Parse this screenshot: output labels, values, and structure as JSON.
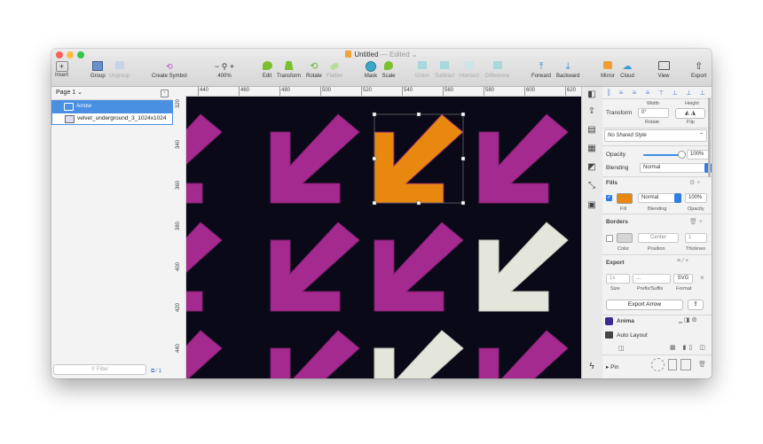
{
  "window": {
    "title": "Untitled",
    "title_suffix": " — Edited ⌄",
    "traffic_lights": [
      "#fc605c",
      "#fdbc40",
      "#34c84a"
    ]
  },
  "toolbar": {
    "insert": "Insert",
    "group": "Group",
    "ungroup": "Ungroup",
    "create_symbol": "Create Symbol",
    "zoom_level": "400%",
    "zoom_controls": "−  ⚲  +",
    "edit": "Edit",
    "transform": "Transform",
    "rotate": "Rotate",
    "flatten": "Flatten",
    "mask": "Mask",
    "scale": "Scale",
    "union": "Union",
    "subtract": "Subtract",
    "intersect": "Intersect",
    "difference": "Difference",
    "forward": "Forward",
    "backward": "Backward",
    "mirror": "Mirror",
    "cloud": "Cloud",
    "view": "View",
    "export": "Export"
  },
  "layers": {
    "page": "Page 1 ⌄",
    "items": [
      {
        "name": "Arrow",
        "icon": "vector-icon"
      },
      {
        "name": "velvet_underground_3_1024x1024",
        "icon": "image-icon"
      }
    ],
    "filter_placeholder": "Filter",
    "bottom_icons": "⧉ ⁄ 1"
  },
  "rulers": {
    "top": [
      "440",
      "460",
      "480",
      "500",
      "520",
      "540",
      "560",
      "580",
      "600",
      "620"
    ],
    "left": [
      "320",
      "340",
      "360",
      "380",
      "400",
      "420",
      "440"
    ]
  },
  "canvas": {
    "background": "#090917",
    "arrows": [
      {
        "color": "#a52a90"
      },
      {
        "color": "#a52a90"
      },
      {
        "color": "#e8880f"
      },
      {
        "color": "#a52a90"
      },
      {
        "color": "#a52a90"
      },
      {
        "color": "#a52a90"
      },
      {
        "color": "#a52a90"
      },
      {
        "color": "#e4e6dc"
      },
      {
        "color": "#a52a90"
      },
      {
        "color": "#a52a90"
      },
      {
        "color": "#e4e6dc"
      },
      {
        "color": "#a52a90"
      }
    ],
    "selection_color": "#6a6a6a"
  },
  "inspector": {
    "width_label": "Width",
    "height_label": "Height",
    "transform_label": "Transform",
    "rotate_value": "0°",
    "rotate_label": "Rotate",
    "flip_label": "Flip",
    "shared_style": "No Shared Style",
    "opacity_label": "Opacity",
    "opacity_value": "100%",
    "blending_label": "Blending",
    "blending_value": "Normal",
    "fills_header": "Fills",
    "fill_color": "#e8880f",
    "fill_blend": "Normal",
    "fill_opacity": "100%",
    "fill_label": "Fill",
    "fill_blending_label": "Blending",
    "fill_opacity_label": "Opacity",
    "borders_header": "Borders",
    "border_position": "Center",
    "border_thickness": "1",
    "color_label": "Color",
    "position_label": "Position",
    "thickness_label": "Thicknes",
    "export_header": "Export",
    "export_size": "1x",
    "export_prefix": "...",
    "export_format": "SVG",
    "size_label": "Size",
    "prefix_label": "Prefix/Suffix",
    "format_label": "Format",
    "export_button": "Export Arrow",
    "anima_label": "Anima",
    "auto_layout_label": "Auto Layout",
    "pin_label": "Pin"
  }
}
